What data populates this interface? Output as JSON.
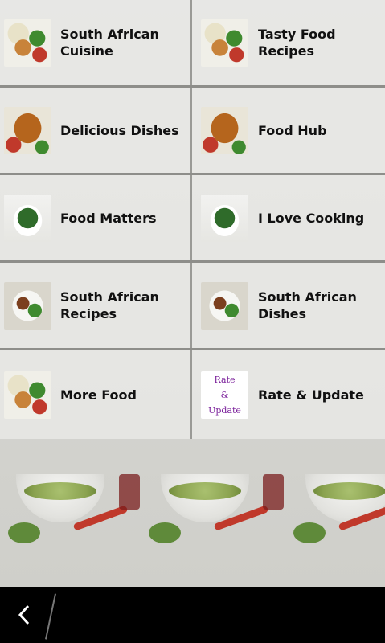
{
  "menu": {
    "items": [
      {
        "label": "South African\nCuisine",
        "thumb": "falafel-plate-image"
      },
      {
        "label": "Tasty Food\nRecipes",
        "thumb": "falafel-plate-image"
      },
      {
        "label": "Delicious Dishes",
        "thumb": "curry-dish-image"
      },
      {
        "label": "Food Hub",
        "thumb": "curry-dish-image"
      },
      {
        "label": "Food Matters",
        "thumb": "salad-bowl-image"
      },
      {
        "label": "I Love Cooking",
        "thumb": "salad-bowl-image"
      },
      {
        "label": "South African\nRecipes",
        "thumb": "meat-salad-image"
      },
      {
        "label": "South African\nDishes",
        "thumb": "meat-salad-image"
      },
      {
        "label": "More Food",
        "thumb": "falafel-plate-image"
      },
      {
        "label": "Rate & Update",
        "thumb": "rate-update-image"
      }
    ],
    "rate_thumb_text": [
      "Rate",
      "&",
      "Update"
    ]
  },
  "navbar": {
    "back_icon": "chevron-left-icon"
  },
  "colors": {
    "cell_bg": "#ebebe8",
    "divider": "#8e8e8a",
    "navbar": "#000000",
    "rate_text": "#7a1f9a"
  }
}
